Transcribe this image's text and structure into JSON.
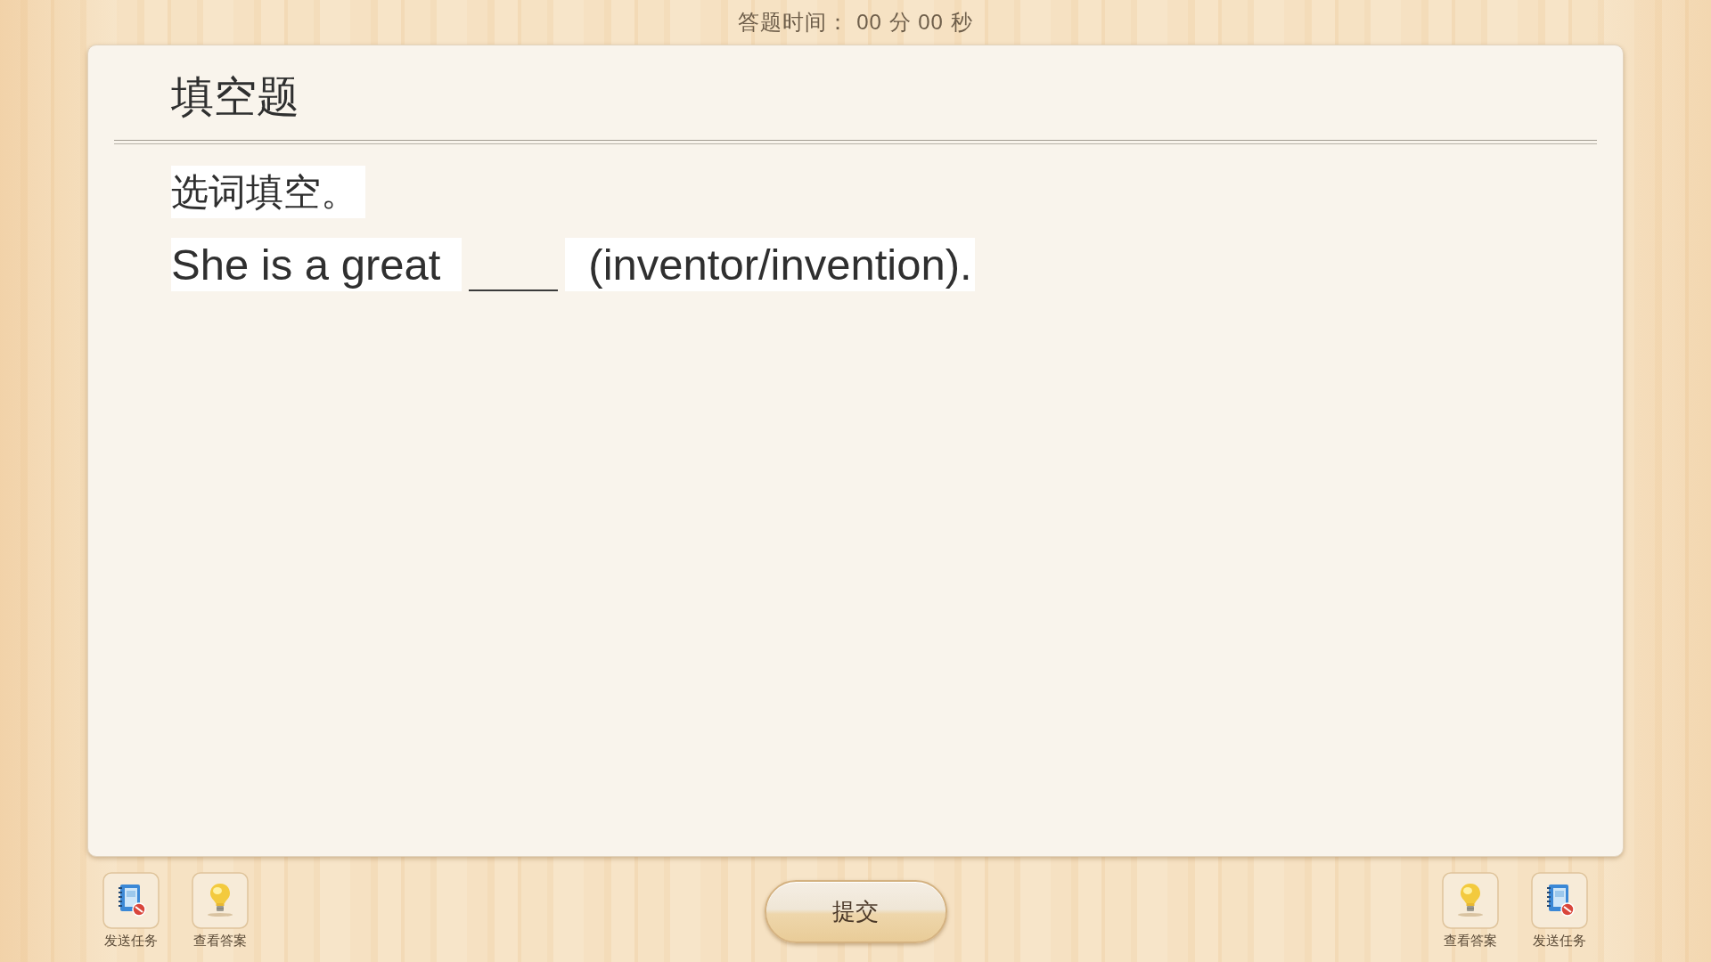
{
  "timer": "答题时间： 00 分 00 秒",
  "question": {
    "title": "填空题",
    "instruction": "选词填空。",
    "sentence": [
      {
        "kind": "text",
        "text": "She is a great"
      },
      {
        "kind": "blank"
      },
      {
        "kind": "text",
        "text": "(inventor/invention)."
      }
    ]
  },
  "toolbar_left": [
    {
      "kind": "send_task",
      "label": "发送任务"
    },
    {
      "kind": "view_answer",
      "label": "查看答案"
    }
  ],
  "submit_button": "提交",
  "toolbar_right": [
    {
      "kind": "view_answer",
      "label": "查看答案"
    },
    {
      "kind": "send_task",
      "label": "发送任务"
    }
  ]
}
